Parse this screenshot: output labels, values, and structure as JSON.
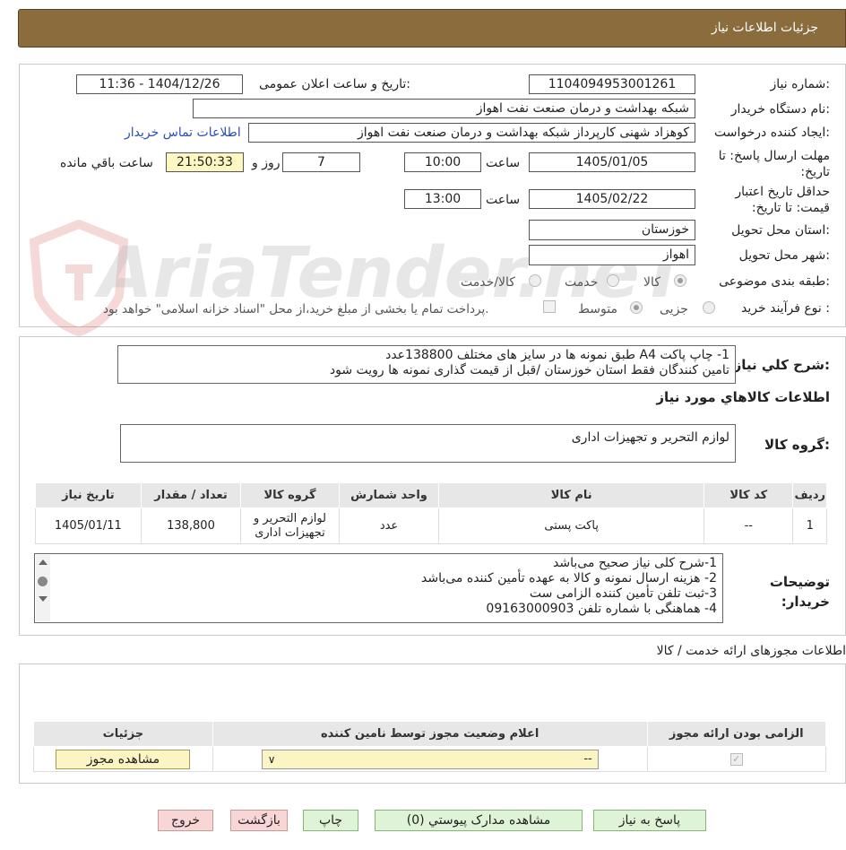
{
  "header": {
    "title": "جزئیات اطلاعات نیاز"
  },
  "form": {
    "need_number_label": "شماره نیاز:",
    "need_number": "1104094953001261",
    "announce_label": "تاریخ و ساعت اعلان عمومی:",
    "announce_value": "1404/12/26 - 11:36",
    "buyer_org_label": "نام دستگاه خریدار:",
    "buyer_org": "شبکه بهداشت و درمان صنعت نفت اهواز",
    "creator_label": "ایجاد کننده درخواست:",
    "creator": "کوهزاد شهنی کارپرداز شبکه بهداشت و درمان صنعت نفت اهواز",
    "contact_link": "اطلاعات تماس خریدار",
    "deadline_label": "مهلت ارسال پاسخ: تا تاریخ:",
    "deadline_date": "1405/01/05",
    "time_label": "ساعت",
    "deadline_time": "10:00",
    "days": "7",
    "days_label": "روز و",
    "remaining": "21:50:33",
    "remaining_label": "ساعت باقي مانده",
    "validity_label": "حداقل تاریخ اعتبار قیمت: تا تاریخ:",
    "validity_date": "1405/02/22",
    "validity_time": "13:00",
    "province_label": "استان محل تحویل:",
    "province": "خوزستان",
    "city_label": "شهر محل تحویل:",
    "city": "اهواز",
    "category_label": "طبقه بندی موضوعی:",
    "category_options": [
      "کالا",
      "خدمت",
      "کالا/خدمت"
    ],
    "process_label": "نوع فرآیند خرید :",
    "process_options": [
      "جزیی",
      "متوسط"
    ],
    "process_note": "پرداخت تمام یا بخشی از مبلغ خرید،از محل \"اسناد خزانه اسلامی\" خواهد بود."
  },
  "summary": {
    "label": "شرح کلي نياز:",
    "line1": "1- چاپ پاکت A4 طبق نمونه ها در سایز های مختلف 138800عدد",
    "line2": "تامین کنندگان فقط استان خوزستان /قبل از قیمت گذاری نمونه ها رویت شود",
    "goods_info_title": "اطلاعات کالاهاي مورد نياز",
    "group_label": "گروه کالا:",
    "group_value": "لوازم التحریر و تجهیزات اداری"
  },
  "items_table": {
    "headers": [
      "رديف",
      "کد کالا",
      "نام کالا",
      "واحد شمارش",
      "گروه کالا",
      "تعداد / مقدار",
      "تاريخ نياز"
    ],
    "rows": [
      [
        "1",
        "--",
        "پاکت پستی",
        "عدد",
        "لوازم التحریر و تجهیزات اداری",
        "138,800",
        "1405/01/11"
      ]
    ]
  },
  "buyer_notes": {
    "label": "توضیحات خریدار:",
    "lines": [
      "1-شرح کلی نیاز صحیح می‌باشد",
      "2- هزینه ارسال نمونه و کالا به عهده تأمین کننده می‌باشد",
      "3-ثبت تلفن تأمین کننده الزامی ست",
      "4- هماهنگی با شماره تلفن 09163000903"
    ]
  },
  "permits": {
    "title": "اطلاعات مجوزهای ارائه خدمت / کالا",
    "headers": [
      "الزامی بودن ارائه مجوز",
      "اعلام وضعیت مجوز توسط نامین کننده",
      "جزئیات"
    ],
    "select_value": "--",
    "view_button": "مشاهده مجوز"
  },
  "buttons": {
    "reply": "پاسخ به نیاز",
    "docs": "مشاهده مدارک پیوستي (0)",
    "print": "چاپ",
    "back": "بازگشت",
    "exit": "خروج"
  },
  "watermark": "AriaTender.neT"
}
